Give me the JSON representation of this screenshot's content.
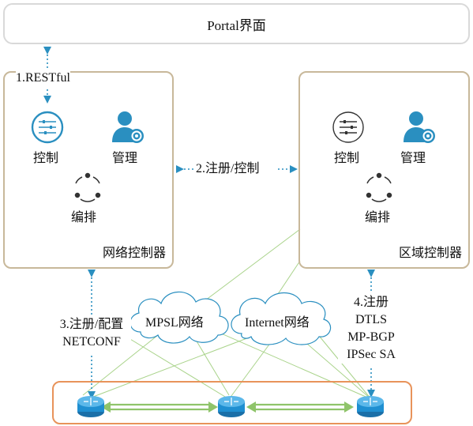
{
  "portal": {
    "label": "Portal界面"
  },
  "net_controller": {
    "name": "网络控制器",
    "control": "控制",
    "manage": "管理",
    "orchestrate": "编排"
  },
  "area_controller": {
    "name": "区域控制器",
    "control": "控制",
    "manage": "管理",
    "orchestrate": "编排"
  },
  "links": {
    "restful": "1.RESTful",
    "register_control": "2.注册/控制",
    "register_config_line1": "3.注册/配置",
    "register_config_line2": "NETCONF",
    "register_line1": "4.注册",
    "register_line2": "DTLS",
    "register_line3": "MP-BGP",
    "register_line4": "IPSec SA"
  },
  "clouds": {
    "mpls": "MPSL网络",
    "internet": "Internet网络"
  },
  "colors": {
    "controller_border": "#c8b89a",
    "device_band_border": "#e8935a",
    "arrow_blue": "#2a8fc0",
    "link_green": "#8fc46a",
    "router_blue": "#1f8fd1"
  },
  "icons": [
    "control-panel-icon",
    "admin-gear-icon",
    "orchestrate-cycle-icon",
    "router-icon",
    "cloud-icon"
  ]
}
